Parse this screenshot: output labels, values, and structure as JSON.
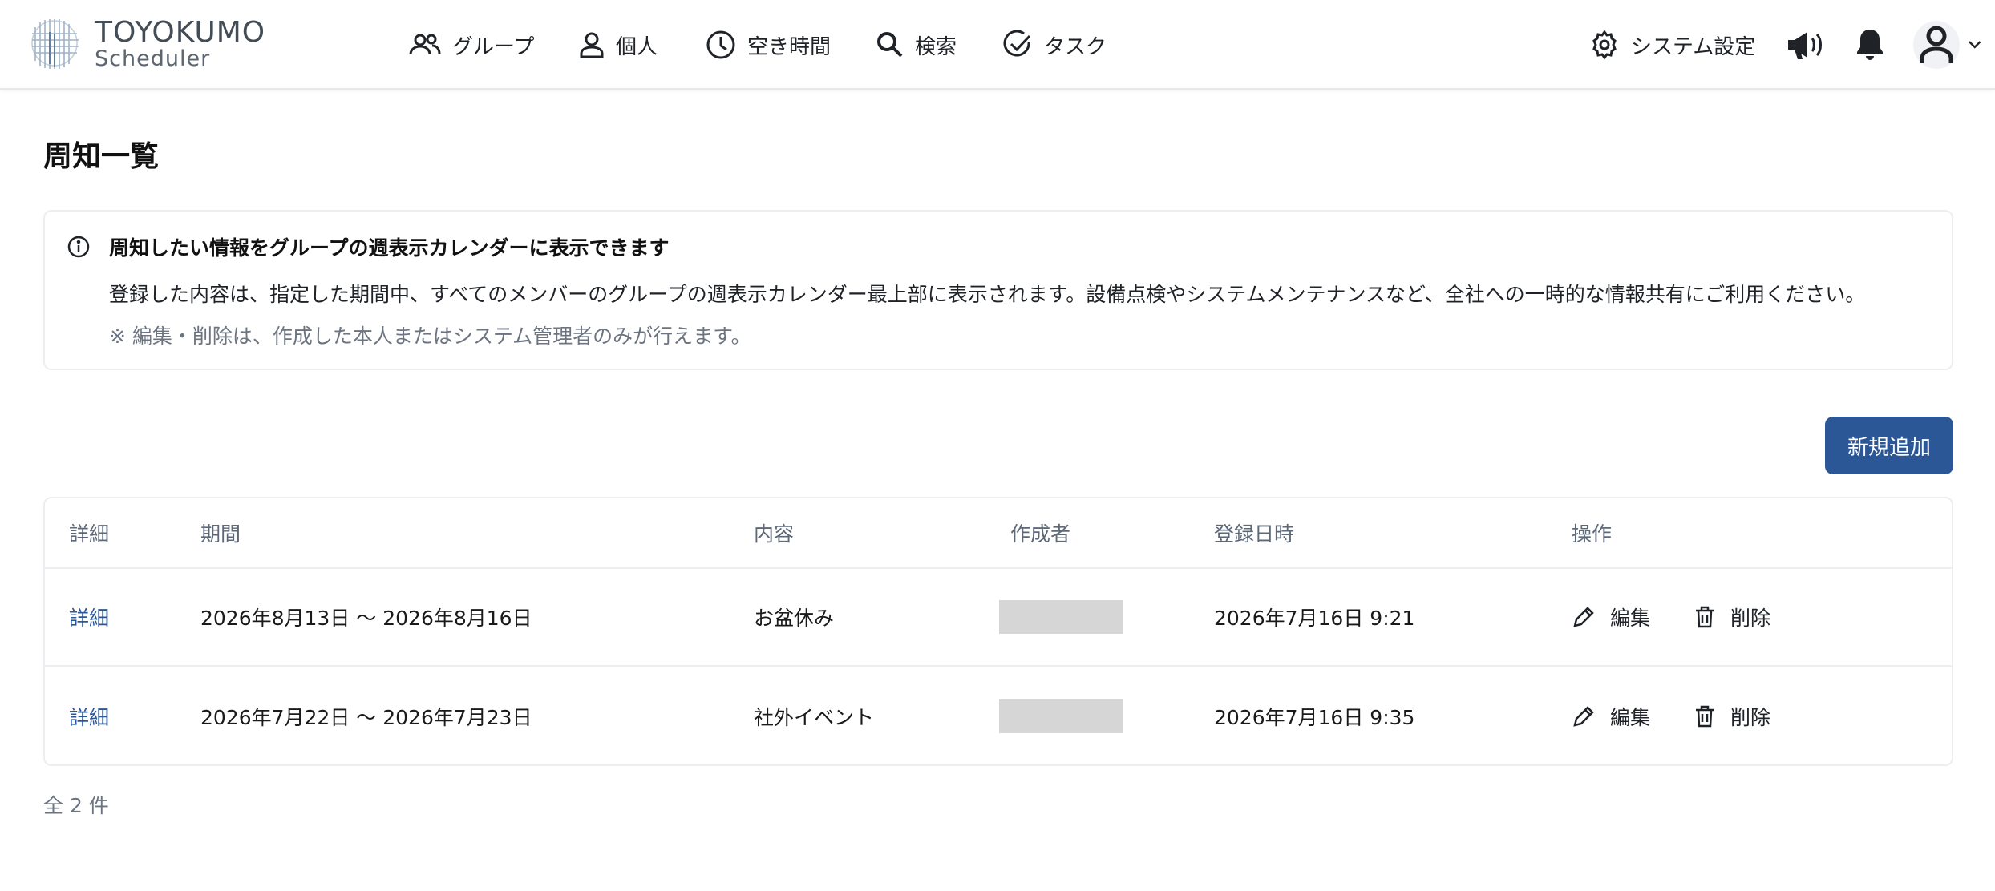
{
  "brand": {
    "name": "TOYOKUMO",
    "product": "Scheduler"
  },
  "nav": [
    {
      "label": "グループ",
      "icon": "group-icon"
    },
    {
      "label": "個人",
      "icon": "person-icon"
    },
    {
      "label": "空き時間",
      "icon": "clock-icon"
    },
    {
      "label": "検索",
      "icon": "search-icon"
    },
    {
      "label": "タスク",
      "icon": "check-circle-icon"
    }
  ],
  "header_right": {
    "settings_label": "システム設定",
    "icons": [
      "gear-icon",
      "megaphone-icon",
      "bell-icon",
      "user-icon",
      "chevron-down-icon"
    ]
  },
  "page": {
    "title": "周知一覧"
  },
  "info": {
    "heading": "周知したい情報をグループの週表示カレンダーに表示できます",
    "body": "登録した内容は、指定した期間中、すべてのメンバーのグループの週表示カレンダー最上部に表示されます。設備点検やシステムメンテナンスなど、全社への一時的な情報共有にご利用ください。",
    "note": "※ 編集・削除は、作成した本人またはシステム管理者のみが行えます。"
  },
  "actions": {
    "add_label": "新規追加"
  },
  "table": {
    "headers": [
      "詳細",
      "期間",
      "内容",
      "作成者",
      "登録日時",
      "操作"
    ],
    "rows": [
      {
        "detail": "詳細",
        "period": "2026年8月13日 〜 2026年8月16日",
        "content": "お盆休み",
        "author": "",
        "registered": "2026年7月16日 9:21",
        "edit": "編集",
        "delete": "削除"
      },
      {
        "detail": "詳細",
        "period": "2026年7月22日 〜 2026年7月23日",
        "content": "社外イベント",
        "author": "",
        "registered": "2026年7月16日 9:35",
        "edit": "編集",
        "delete": "削除"
      }
    ]
  },
  "footer": {
    "total": "全 2 件"
  },
  "colors": {
    "primary": "#2b5797",
    "link": "#2b5797",
    "muted": "#6b7480",
    "border": "#eceef1",
    "redacted": "#d6d6d6"
  }
}
